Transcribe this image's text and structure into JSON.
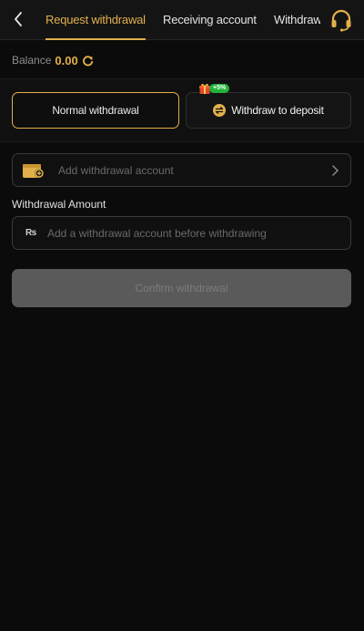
{
  "header": {
    "tabs": [
      {
        "label": "Request withdrawal",
        "active": true
      },
      {
        "label": "Receiving account",
        "active": false
      },
      {
        "label": "Withdrawal",
        "active": false
      }
    ]
  },
  "balance": {
    "label": "Balance",
    "value": "0.00"
  },
  "modes": {
    "normal_label": "Normal withdrawal",
    "deposit_label": "Withdraw to deposit",
    "promo_badge": "+5%"
  },
  "account_field": {
    "placeholder": "Add withdrawal account"
  },
  "amount": {
    "label": "Withdrawal Amount",
    "currency_symbol": "₨",
    "placeholder": "Add a withdrawal account before withdrawing",
    "value": ""
  },
  "confirm_button": {
    "label": "Confirm withdrawal"
  },
  "colors": {
    "accent": "#e2b04a",
    "background": "#0b0b0b",
    "badge": "#22b33a",
    "disabled_button": "#5a5a5a"
  },
  "icons": {
    "back": "chevron-left-icon",
    "support": "headset-icon",
    "refresh": "refresh-icon",
    "wallet": "wallet-add-icon",
    "exchange": "exchange-icon",
    "gift": "gift-icon",
    "chevron": "chevron-right-icon"
  }
}
